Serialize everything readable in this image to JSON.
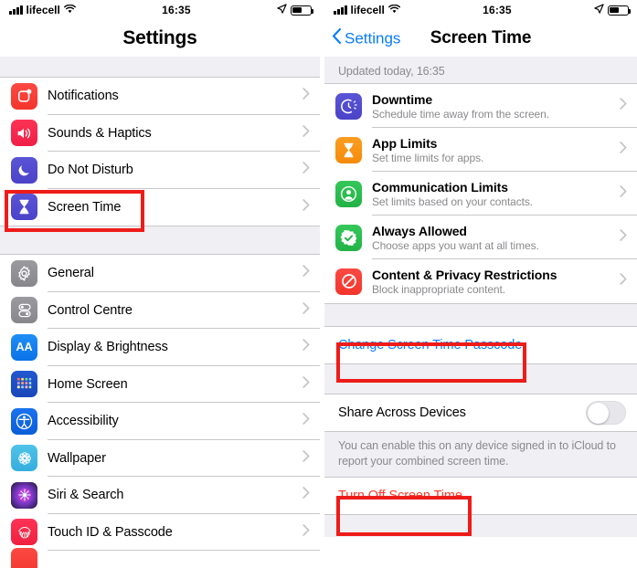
{
  "status_bar": {
    "carrier": "lifecell",
    "time": "16:35",
    "signal_icon": "cellular-bars-icon",
    "wifi_icon": "wifi-icon",
    "location_icon": "location-arrow-icon",
    "battery_icon": "battery-icon",
    "battery_level": 45
  },
  "colors": {
    "accent_blue": "#0a7cff",
    "destructive_red": "#ff3b30",
    "highlight_box": "#ee1c19",
    "list_background": "#efeff4",
    "separator": "#c8c7cc",
    "secondary_text": "#8a8a8e"
  },
  "left_panel": {
    "nav": {
      "title": "Settings"
    },
    "groups": [
      {
        "rows": [
          {
            "label": "Notifications",
            "icon": "notifications-icon",
            "icon_class": "ic-notif",
            "glyph": "notif"
          },
          {
            "label": "Sounds & Haptics",
            "icon": "sounds-haptics-icon",
            "icon_class": "ic-sounds",
            "glyph": "speaker"
          },
          {
            "label": "Do Not Disturb",
            "icon": "do-not-disturb-icon",
            "icon_class": "ic-dnd",
            "glyph": "moon"
          },
          {
            "label": "Screen Time",
            "icon": "screen-time-icon",
            "icon_class": "ic-screen",
            "glyph": "hourglass",
            "highlighted": true
          }
        ]
      },
      {
        "rows": [
          {
            "label": "General",
            "icon": "general-gear-icon",
            "icon_class": "ic-gen",
            "glyph": "gear"
          },
          {
            "label": "Control Centre",
            "icon": "control-centre-icon",
            "icon_class": "ic-cc",
            "glyph": "sliders"
          },
          {
            "label": "Display & Brightness",
            "icon": "display-brightness-icon",
            "icon_class": "ic-disp",
            "glyph": "aa"
          },
          {
            "label": "Home Screen",
            "icon": "home-screen-icon",
            "icon_class": "ic-home",
            "glyph": "grid"
          },
          {
            "label": "Accessibility",
            "icon": "accessibility-icon",
            "icon_class": "ic-acc",
            "glyph": "accessibility"
          },
          {
            "label": "Wallpaper",
            "icon": "wallpaper-icon",
            "icon_class": "ic-wall",
            "glyph": "flower"
          },
          {
            "label": "Siri & Search",
            "icon": "siri-search-icon",
            "icon_class": "ic-siri",
            "glyph": "siri"
          },
          {
            "label": "Touch ID & Passcode",
            "icon": "touch-id-passcode-icon",
            "icon_class": "ic-touch",
            "glyph": "fingerprint"
          }
        ]
      }
    ]
  },
  "right_panel": {
    "nav": {
      "back_label": "Settings",
      "title": "Screen Time"
    },
    "updated_label": "Updated today, 16:35",
    "feature_rows": [
      {
        "title": "Downtime",
        "subtitle": "Schedule time away from the screen.",
        "icon": "downtime-icon",
        "icon_class": "ic-downtime",
        "glyph": "downtime"
      },
      {
        "title": "App Limits",
        "subtitle": "Set time limits for apps.",
        "icon": "app-limits-icon",
        "icon_class": "ic-applim",
        "glyph": "hourglass-orange"
      },
      {
        "title": "Communication Limits",
        "subtitle": "Set limits based on your contacts.",
        "icon": "communication-limits-icon",
        "icon_class": "ic-comm",
        "glyph": "person"
      },
      {
        "title": "Always Allowed",
        "subtitle": "Choose apps you want at all times.",
        "icon": "always-allowed-icon",
        "icon_class": "ic-allow",
        "glyph": "checkbadge"
      },
      {
        "title": "Content & Privacy Restrictions",
        "subtitle": "Block inappropriate content.",
        "icon": "content-privacy-restrictions-icon",
        "icon_class": "ic-content",
        "glyph": "noentry"
      }
    ],
    "change_passcode_label": "Change Screen Time Passcode",
    "share_across_devices": {
      "label": "Share Across Devices",
      "enabled": false
    },
    "share_footer": "You can enable this on any device signed in to iCloud to report your combined screen time.",
    "turn_off_label": "Turn Off Screen Time"
  },
  "annotations": [
    {
      "name": "screen-time-highlight"
    },
    {
      "name": "change-passcode-highlight"
    },
    {
      "name": "turn-off-highlight"
    }
  ]
}
